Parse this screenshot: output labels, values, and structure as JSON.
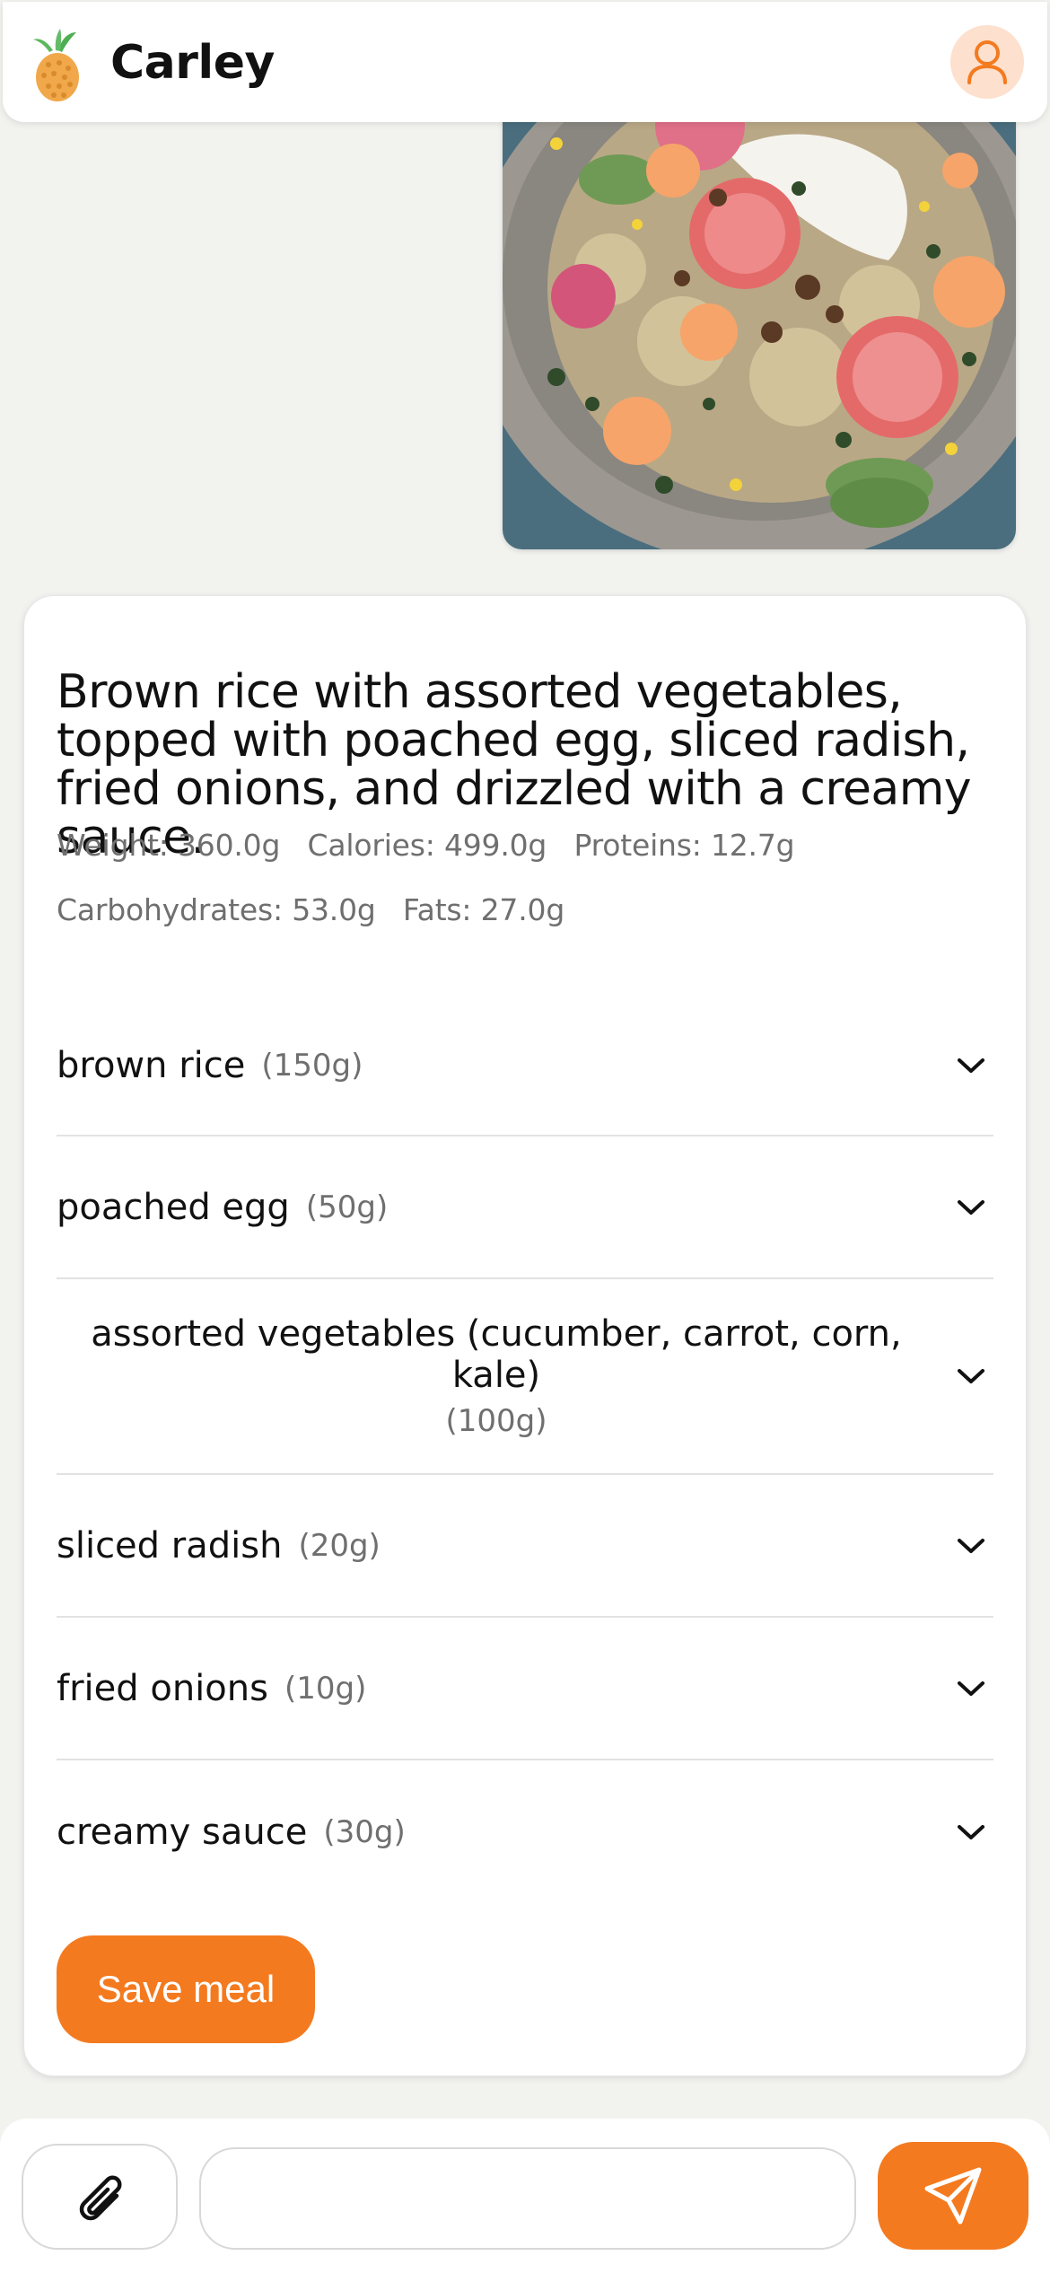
{
  "app": {
    "title": "Carley"
  },
  "colors": {
    "accent": "#f47a1f",
    "avatar_bg": "#fde0cd",
    "muted_text": "#6f6f6f"
  },
  "icons": {
    "logo": "pineapple-logo-icon",
    "profile": "user-icon",
    "expand": "chevron-down-icon",
    "attach": "paperclip-icon",
    "send": "paper-plane-icon"
  },
  "meal": {
    "title": "Brown rice with assorted vegetables, topped with poached egg, sliced radish, fried onions, and drizzled with a creamy sauce.",
    "stats": {
      "weight": "Weight: 360.0g",
      "calories": "Calories: 499.0g",
      "proteins": "Proteins: 12.7g",
      "carbohydrates": "Carbohydrates: 53.0g",
      "fats": "Fats: 27.0g"
    },
    "ingredients": [
      {
        "name": "brown rice",
        "qty": "(150g)"
      },
      {
        "name": "poached egg",
        "qty": "(50g)"
      },
      {
        "name": "assorted vegetables (cucumber, carrot, corn, kale)",
        "qty": "(100g)"
      },
      {
        "name": "sliced radish",
        "qty": "(20g)"
      },
      {
        "name": "fried onions",
        "qty": "(10g)"
      },
      {
        "name": "creamy sauce",
        "qty": "(30g)"
      }
    ],
    "save_label": "Save meal"
  },
  "composer": {
    "placeholder": ""
  }
}
